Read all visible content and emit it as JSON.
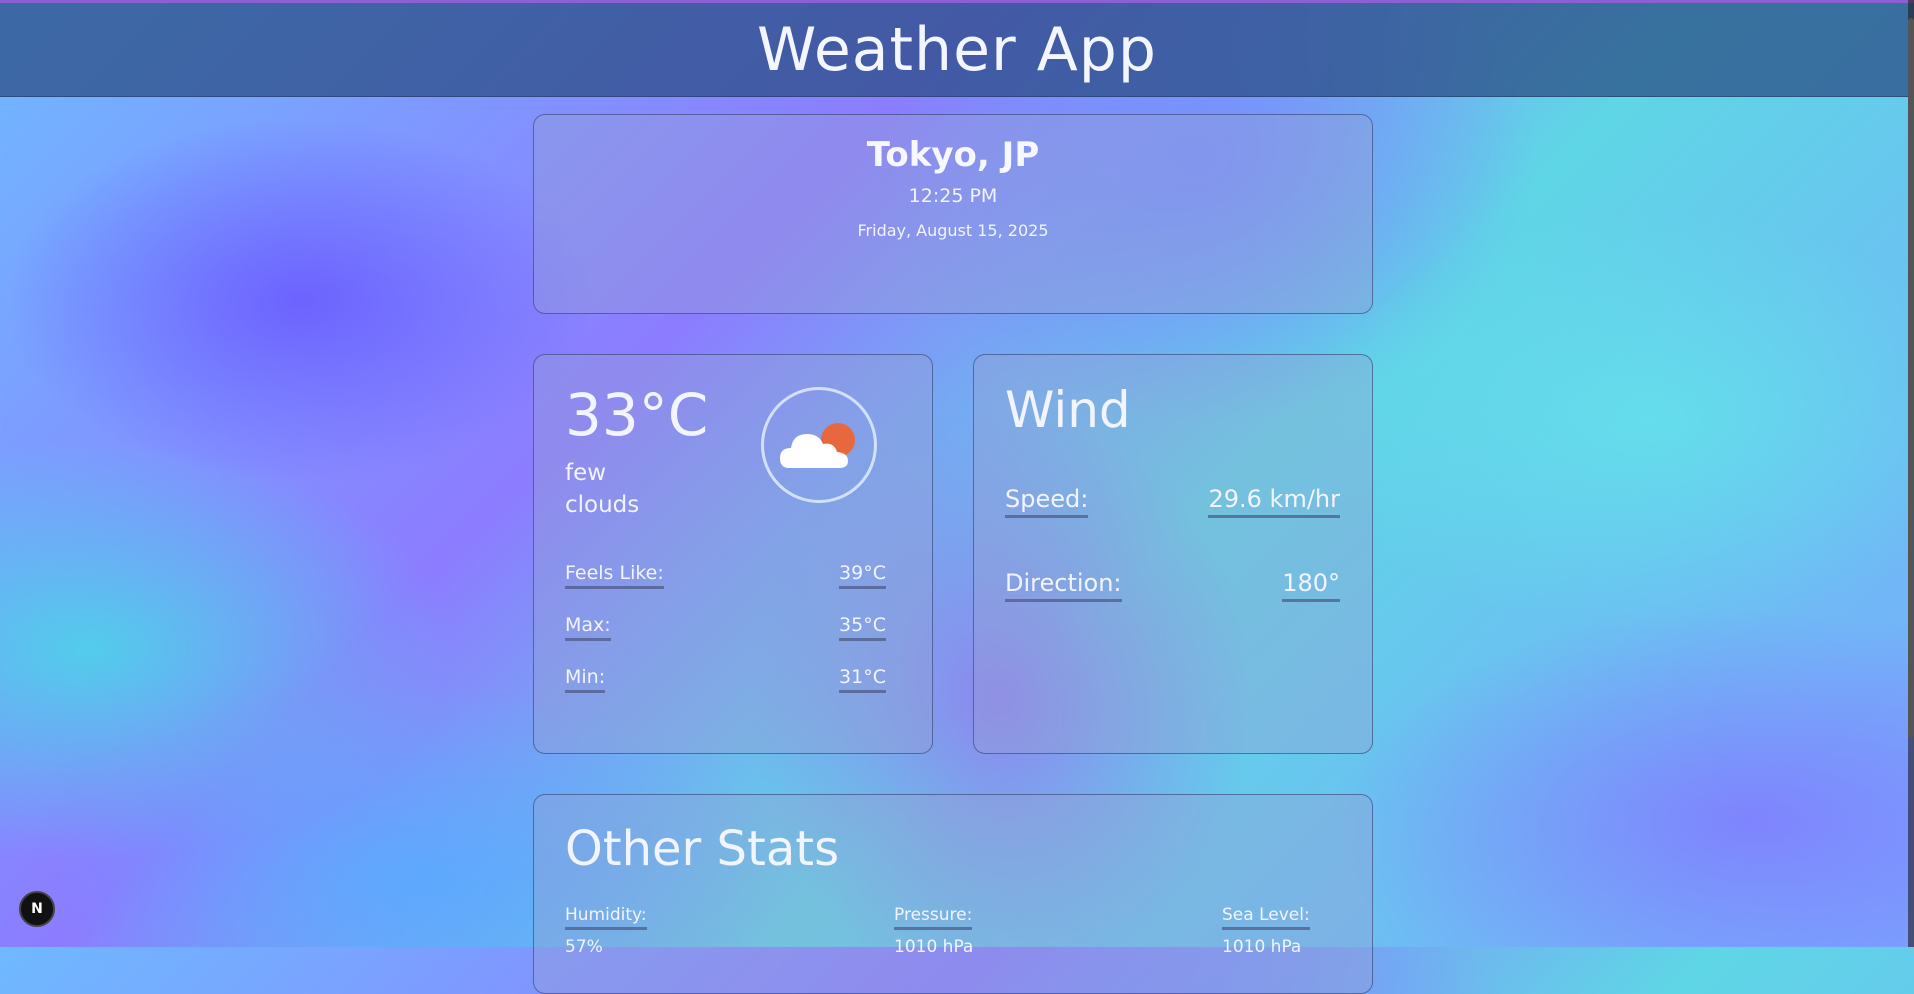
{
  "header": {
    "title": "Weather App"
  },
  "location": {
    "city": "Tokyo, JP",
    "time": "12:25 PM",
    "date": "Friday, August 15, 2025"
  },
  "current": {
    "temp": "33°C",
    "description_line1": "few",
    "description_line2": "clouds",
    "icon": "partly-cloudy-icon",
    "feels_like_label": "Feels Like:",
    "feels_like_value": "39°C",
    "max_label": "Max:",
    "max_value": "35°C",
    "min_label": "Min:",
    "min_value": "31°C"
  },
  "wind": {
    "title": "Wind",
    "speed_label": "Speed:",
    "speed_value": "29.6 km/hr",
    "direction_label": "Direction:",
    "direction_value": "180°"
  },
  "other": {
    "title": "Other Stats",
    "humidity_label": "Humidity:",
    "humidity_value": "57%",
    "pressure_label": "Pressure:",
    "pressure_value": "1010 hPa",
    "sea_level_label": "Sea Level:",
    "sea_level_value": "1010 hPa"
  },
  "dev_badge": {
    "label": "N"
  },
  "colors": {
    "sun": "#e8683e",
    "cloud": "#ffffff",
    "header_bg": "#284b82"
  }
}
